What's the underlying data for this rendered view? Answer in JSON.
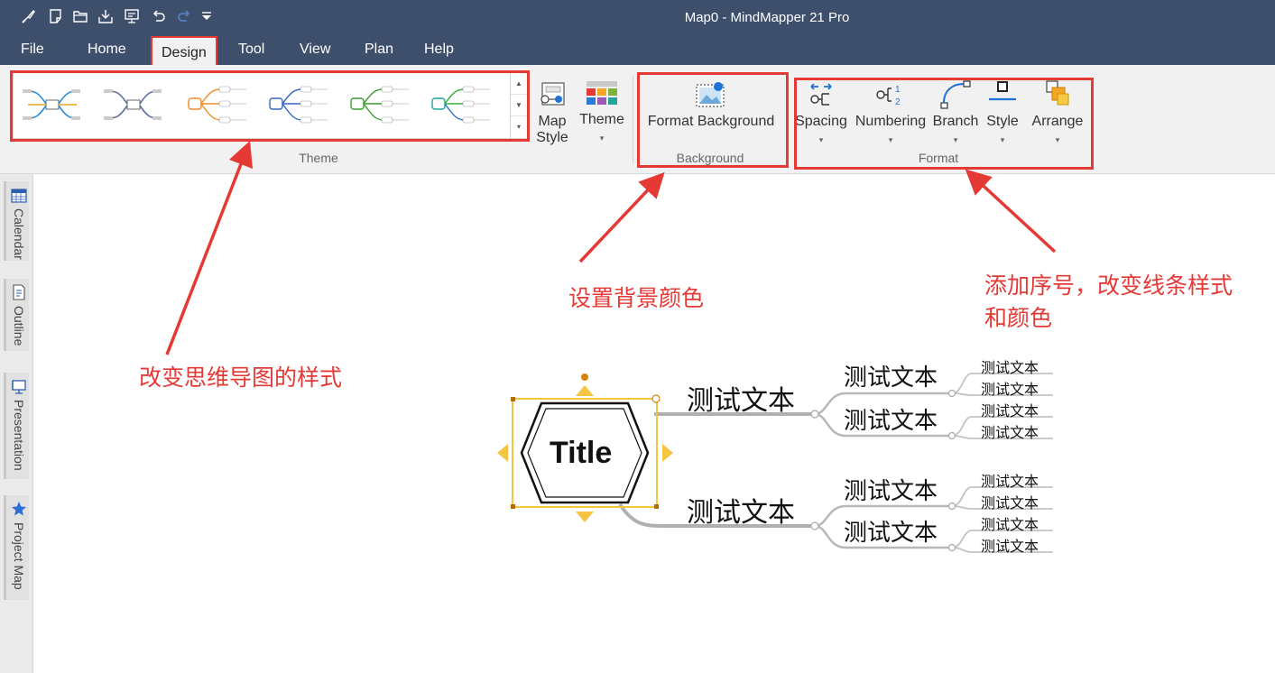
{
  "window": {
    "title": "Map0 -  MindMapper 21 Pro"
  },
  "quick_access": [
    {
      "icon": "brush-icon"
    },
    {
      "icon": "new-note-icon"
    },
    {
      "icon": "open-folder-icon"
    },
    {
      "icon": "save-download-icon"
    },
    {
      "icon": "presentation-monitor-icon"
    },
    {
      "icon": "undo-icon"
    },
    {
      "icon": "redo-icon"
    },
    {
      "icon": "customize-dropdown-icon"
    }
  ],
  "menu": {
    "file": "File",
    "home": "Home",
    "design": "Design",
    "tool": "Tool",
    "view": "View",
    "plan": "Plan",
    "help": "Help"
  },
  "ribbon": {
    "theme_group": {
      "label": "Theme",
      "gallery_count": 6
    },
    "map_style": {
      "line1": "Map",
      "line2": "Style"
    },
    "theme_button": {
      "label": "Theme"
    },
    "background_group": {
      "label": "Background",
      "format_background": "Format Background"
    },
    "format_group": {
      "label": "Format",
      "spacing": "Spacing",
      "numbering": "Numbering",
      "branch": "Branch",
      "style": "Style",
      "arrange": "Arrange"
    }
  },
  "side_tabs": {
    "calendar": "Calendar",
    "outline": "Outline",
    "presentation": "Presentation",
    "project_map": "Project Map"
  },
  "annotations": {
    "theme_note": "改变思维导图的样式",
    "background_note": "设置背景颜色",
    "format_note_line1": "添加序号，改变线条样式",
    "format_note_line2": "和颜色"
  },
  "mindmap": {
    "central_title": "Title",
    "branches": [
      {
        "label": "测试文本",
        "children": [
          {
            "label": "测试文本",
            "children": [
              "测试文本",
              "测试文本"
            ]
          },
          {
            "label": "测试文本",
            "children": [
              "测试文本",
              "测试文本"
            ]
          }
        ]
      },
      {
        "label": "测试文本",
        "children": [
          {
            "label": "测试文本",
            "children": [
              "测试文本",
              "测试文本"
            ]
          },
          {
            "label": "测试文本",
            "children": [
              "测试文本",
              "测试文本"
            ]
          }
        ]
      }
    ]
  },
  "colors": {
    "titlebar": "#3d4f6b",
    "highlight": "#e53935",
    "accent_blue": "#1e73d6",
    "handle_yellow": "#f5c542"
  }
}
